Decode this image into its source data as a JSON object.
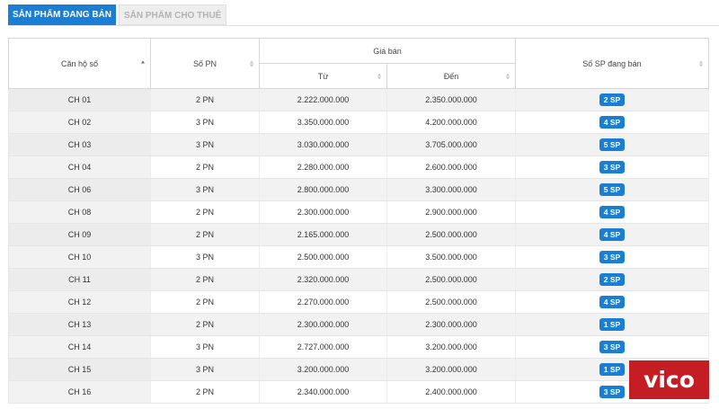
{
  "tabs": [
    {
      "label": "SẢN PHẨM ĐANG BÁN",
      "active": true
    },
    {
      "label": "SẢN PHẨM CHO THUÊ",
      "active": false
    }
  ],
  "table": {
    "headers": {
      "unit": "Căn hộ số",
      "bedrooms": "Số PN",
      "price_group": "Giá bán",
      "price_from": "Từ",
      "price_to": "Đến",
      "count": "Số SP đang bán"
    },
    "rows": [
      {
        "unit": "CH 01",
        "bedrooms": "2 PN",
        "from": "2.222.000.000",
        "to": "2.350.000.000",
        "count": "2 SP"
      },
      {
        "unit": "CH 02",
        "bedrooms": "3 PN",
        "from": "3.350.000.000",
        "to": "4.200.000.000",
        "count": "4 SP"
      },
      {
        "unit": "CH 03",
        "bedrooms": "3 PN",
        "from": "3.030.000.000",
        "to": "3.705.000.000",
        "count": "5 SP"
      },
      {
        "unit": "CH 04",
        "bedrooms": "2 PN",
        "from": "2.280.000.000",
        "to": "2.600.000.000",
        "count": "3 SP"
      },
      {
        "unit": "CH 06",
        "bedrooms": "3 PN",
        "from": "2.800.000.000",
        "to": "3.300.000.000",
        "count": "5 SP"
      },
      {
        "unit": "CH 08",
        "bedrooms": "2 PN",
        "from": "2.300.000.000",
        "to": "2.900.000.000",
        "count": "4 SP"
      },
      {
        "unit": "CH 09",
        "bedrooms": "2 PN",
        "from": "2.165.000.000",
        "to": "2.500.000.000",
        "count": "4 SP"
      },
      {
        "unit": "CH 10",
        "bedrooms": "3 PN",
        "from": "2.500.000.000",
        "to": "3.500.000.000",
        "count": "3 SP"
      },
      {
        "unit": "CH 11",
        "bedrooms": "2 PN",
        "from": "2.320.000.000",
        "to": "2.500.000.000",
        "count": "2 SP"
      },
      {
        "unit": "CH 12",
        "bedrooms": "2 PN",
        "from": "2.270.000.000",
        "to": "2.500.000.000",
        "count": "4 SP"
      },
      {
        "unit": "CH 13",
        "bedrooms": "2 PN",
        "from": "2.300.000.000",
        "to": "2.300.000.000",
        "count": "1 SP"
      },
      {
        "unit": "CH 14",
        "bedrooms": "3 PN",
        "from": "2.727.000.000",
        "to": "3.200.000.000",
        "count": "3 SP"
      },
      {
        "unit": "CH 15",
        "bedrooms": "3 PN",
        "from": "3.200.000.000",
        "to": "3.200.000.000",
        "count": "1 SP"
      },
      {
        "unit": "CH 16",
        "bedrooms": "2 PN",
        "from": "2.340.000.000",
        "to": "2.400.000.000",
        "count": "3 SP"
      }
    ]
  },
  "watermark": {
    "label": "vico"
  },
  "colors": {
    "accent": "#1a7fd4",
    "logo_bg": "#c41e24"
  }
}
